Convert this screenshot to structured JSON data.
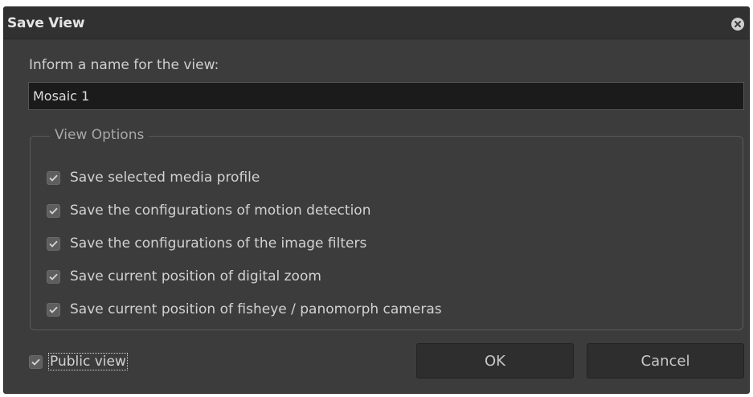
{
  "dialog": {
    "title": "Save View",
    "close_icon": "close-circle-icon"
  },
  "name": {
    "prompt": "Inform a name for the view:",
    "value": "Mosaic 1"
  },
  "options": {
    "legend": "View Options",
    "items": [
      {
        "label": "Save selected media profile",
        "checked": true
      },
      {
        "label": "Save the configurations of motion detection",
        "checked": true
      },
      {
        "label": "Save the configurations of the image filters",
        "checked": true
      },
      {
        "label": "Save current position of digital zoom",
        "checked": true
      },
      {
        "label": "Save current position of fisheye / panomorph cameras",
        "checked": true
      }
    ]
  },
  "public_view": {
    "label": "Public view",
    "checked": true
  },
  "buttons": {
    "ok_label": "OK",
    "cancel_label": "Cancel"
  },
  "colors": {
    "dialog_bg": "#3c3c3c",
    "titlebar_bg": "#313131",
    "input_bg": "#1b1b1b",
    "text": "#d2d2d2"
  }
}
